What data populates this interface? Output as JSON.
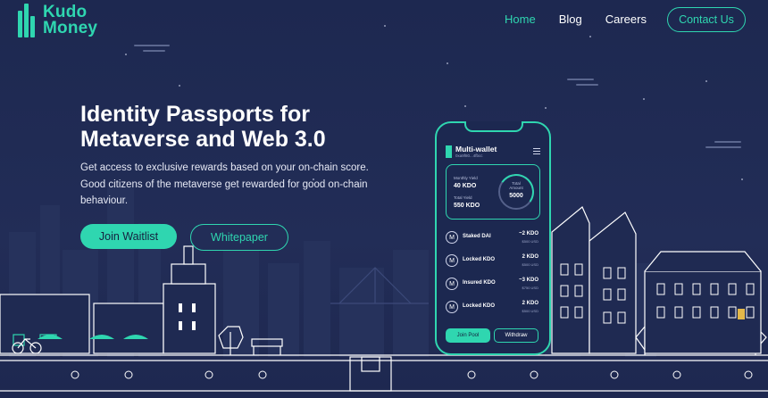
{
  "brand": {
    "line1": "Kudo",
    "line2": "Money",
    "accent": "#2fd6b0",
    "background": "#1f2a52"
  },
  "nav": {
    "items": [
      {
        "label": "Home",
        "active": true
      },
      {
        "label": "Blog",
        "active": false
      },
      {
        "label": "Careers",
        "active": false
      }
    ],
    "contact": "Contact Us"
  },
  "hero": {
    "title_line1": "Identity Passports for",
    "title_line2": "Metaverse and Web 3.0",
    "desc_line1": "Get access to exclusive rewards based on your on-chain score.",
    "desc_line2": "Good citizens of the metaverse get rewarded for good on-chain",
    "desc_line3": "behaviour.",
    "primary_button": "Join Waitlist",
    "secondary_button": "Whitepaper"
  },
  "phone": {
    "title": "Multi-wallet",
    "address": "0xa9f80...4fbcc",
    "monthly_yield_label": "Monthly Yield",
    "monthly_yield_value": "40 KDO",
    "total_yield_label": "Total Yield",
    "total_yield_value": "550 KDO",
    "total_amount_label_1": "Total",
    "total_amount_label_2": "Amount",
    "total_amount_value": "5000",
    "rows": [
      {
        "coin": "M",
        "name": "Staked DAI",
        "amount": "~2 KDO",
        "usd": "$500 USD"
      },
      {
        "coin": "M",
        "name": "Locked KDO",
        "amount": "2 KDO",
        "usd": "$500 USD"
      },
      {
        "coin": "M",
        "name": "Insured KDO",
        "amount": "~3 KDO",
        "usd": "$750 USD"
      },
      {
        "coin": "M",
        "name": "Locked KDO",
        "amount": "2 KDO",
        "usd": "$500 USD"
      }
    ],
    "join_pool": "Join Pool",
    "withdraw": "Withdraw"
  }
}
